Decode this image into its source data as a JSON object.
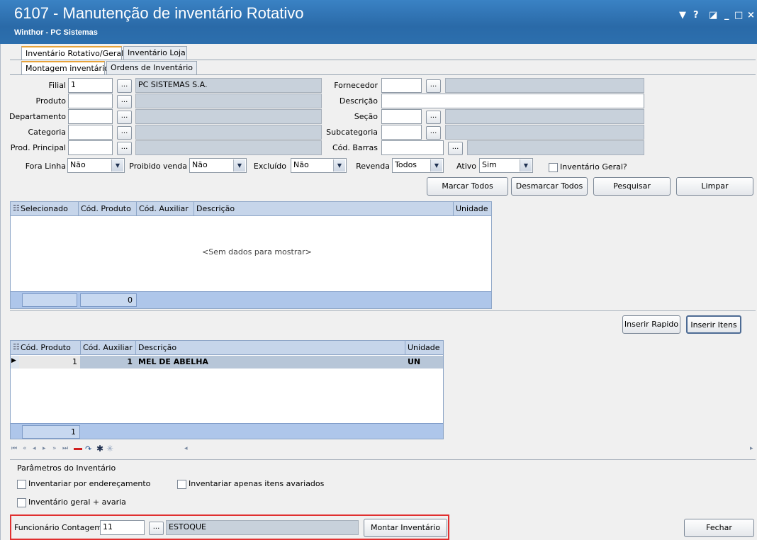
{
  "window": {
    "title": "6107 - Manutenção de inventário Rotativo",
    "subtitle": "Winthor - PC Sistemas",
    "controls": {
      "menu": "▼",
      "help": "?",
      "restore": "◪",
      "minimize": "_",
      "maximize": "□",
      "close": "×"
    }
  },
  "tabs_top": [
    "Inventário Rotativo/Geral",
    "Inventário Loja"
  ],
  "tabs_sub": [
    "Montagem inventário",
    "Ordens de Inventário"
  ],
  "form": {
    "filial_label": "Filial",
    "filial_value": "1",
    "filial_desc": "PC SISTEMAS S.A.",
    "produto_label": "Produto",
    "departamento_label": "Departamento",
    "categoria_label": "Categoria",
    "prod_principal_label": "Prod. Principal",
    "fornecedor_label": "Fornecedor",
    "descricao_label": "Descrição",
    "secao_label": "Seção",
    "subcategoria_label": "Subcategoria",
    "cod_barras_label": "Cód. Barras",
    "dots": "...",
    "fora_linha_label": "Fora Linha",
    "fora_linha_value": "Não",
    "proibido_venda_label": "Proibido venda",
    "proibido_venda_value": "Não",
    "excluido_label": "Excluído",
    "excluido_value": "Não",
    "revenda_label": "Revenda",
    "revenda_value": "Todos",
    "ativo_label": "Ativo",
    "ativo_value": "Sim",
    "inventario_geral_label": "Inventário Geral?"
  },
  "buttons": {
    "marcar_todos": "Marcar Todos",
    "desmarcar_todos": "Desmarcar Todos",
    "pesquisar": "Pesquisar",
    "limpar": "Limpar",
    "inserir_rapido": "Inserir Rapido",
    "inserir_itens": "Inserir Itens",
    "montar_inventario": "Montar Inventário",
    "fechar": "Fechar"
  },
  "grid1": {
    "columns": [
      "Selecionado",
      "Cód. Produto",
      "Cód. Auxiliar",
      "Descrição",
      "Unidade"
    ],
    "empty_text": "<Sem dados para mostrar>",
    "footer_count": "0"
  },
  "grid2": {
    "columns": [
      "Cód. Produto",
      "Cód. Auxiliar",
      "Descrição",
      "Unidade"
    ],
    "rows": [
      {
        "cod_produto": "1",
        "cod_auxiliar": "1",
        "descricao": "MEL DE ABELHA",
        "unidade": "UN"
      }
    ],
    "footer_count": "1"
  },
  "params": {
    "group_title": "Parâmetros do Inventário",
    "por_enderecamento": "Inventariar por endereçamento",
    "apenas_avariados": "Inventariar apenas itens avariados",
    "geral_avaria": "Inventário geral + avaria"
  },
  "funcionario": {
    "label": "Funcionário Contagem",
    "value": "11",
    "desc": "ESTOQUE"
  }
}
